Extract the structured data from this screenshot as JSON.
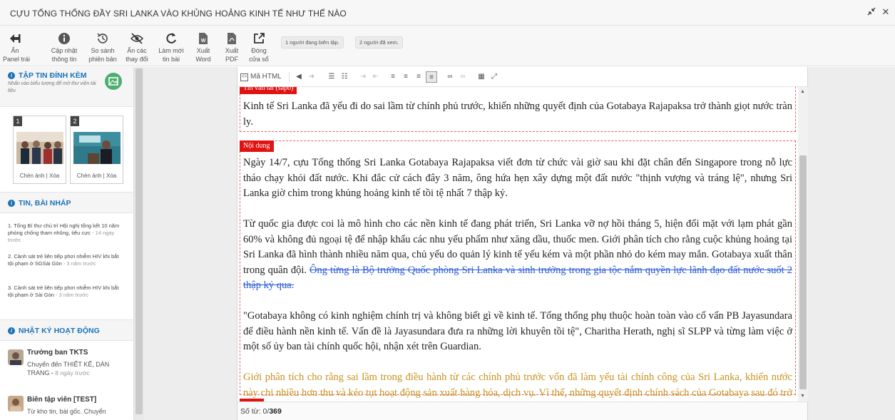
{
  "window": {
    "title": "CỰU TỔNG THỐNG ĐẦY SRI LANKA VÀO KHỦNG HOẢNG KINH TẾ NHƯ THẾ NÀO",
    "collapse_icon": "collapse-arrows-icon",
    "close_label": "✕"
  },
  "toolbar": {
    "buttons": [
      {
        "line1": "Ẩn",
        "line2": "Panel trái",
        "icon": "arrow-left-icon"
      },
      {
        "line1": "Cập nhật",
        "line2": "thông tin",
        "icon": "info-icon"
      },
      {
        "line1": "So sánh",
        "line2": "phiên bản",
        "icon": "history-icon"
      },
      {
        "line1": "Ẩn các",
        "line2": "thay đổi",
        "icon": "eye-slash-icon"
      },
      {
        "line1": "Làm mới",
        "line2": "tin bài",
        "icon": "refresh-icon"
      },
      {
        "line1": "Xuất",
        "line2": "Word",
        "icon": "word-file-icon"
      },
      {
        "line1": "Xuất",
        "line2": "PDF",
        "icon": "pdf-file-icon"
      },
      {
        "line1": "Đóng",
        "line2": "cửa sổ",
        "icon": "external-link-icon"
      }
    ],
    "editing_status": "1 người đang biên tập.",
    "viewed_status": "2 người đã xem."
  },
  "sidebar": {
    "attachments": {
      "title": "TẬP TIN ĐÍNH KÈM",
      "hint": "Nhấn vào biểu tượng để mở thư viện tài liệu",
      "images": [
        {
          "num": "1",
          "caption": "Chèn ảnh | Xóa"
        },
        {
          "num": "2",
          "caption": "Chèn ảnh | Xóa"
        }
      ]
    },
    "drafts": {
      "title": "TIN, BÀI NHÁP",
      "items": [
        {
          "text": "1. Tổng Bí thư chủ trì Hội nghị tổng kết 10 năm phòng chống tham nhũng, tiêu cực",
          "time": " - 14 ngày trước"
        },
        {
          "text": "2. Cảnh sát trẻ liên tiếp phơi nhiễm HIV khi bắt tội phạm ở SGSài Gòn",
          "time": " - 3 năm trước"
        },
        {
          "text": "3. Cảnh sát trẻ liên tiếp phơi nhiễm HIV khi bắt tội phạm ở Sài Gòn",
          "time": " - 3 năm trước"
        }
      ]
    },
    "activity": {
      "title": "NHẬT KÝ HOẠT ĐỘNG",
      "items": [
        {
          "name": "Trưởng ban TKTS",
          "desc": "Chuyển đến THIẾT KẾ, DÀN TRANG",
          "time": " • 8 ngày trước"
        },
        {
          "name": "Biên tập viên [TEST]",
          "desc": "Từ kho tin, bài gốc. Chuyển",
          "time": ""
        }
      ]
    }
  },
  "editor": {
    "html_mode_label": "Mã HTML",
    "sapo_label": "Tin vắn tắt (sapo)",
    "sapo_text": "Kinh tế Sri Lanka đã yếu đi do sai lầm từ chính phủ trước, khiến những quyết định của Gotabaya Rajapaksa trở thành giọt nước tràn ly.",
    "content_label": "Nội dung",
    "paragraphs": {
      "p1": "Ngày 14/7, cựu Tổng thống Sri Lanka Gotabaya Rajapaksa viết đơn từ chức vài giờ sau khi đặt chân đến Singapore trong nỗ lực tháo chạy khỏi đất nước. Khi đắc cử cách đây 3 năm, ông hứa hẹn xây dựng một đất nước \"thịnh vượng và tráng lệ\", nhưng Sri Lanka giờ chìm trong khủng hoảng kinh tế tồi tệ nhất 7 thập kỷ.",
      "p2_plain": "Từ quốc gia được coi là mô hình cho các nền kinh tế đang phát triển, Sri Lanka vỡ nợ hồi tháng 5, hiện đối mặt với lạm phát gần 60% và không đủ ngoại tệ để nhập khẩu các nhu yếu phẩm như xăng dầu, thuốc men. Giới phân tích cho rằng cuộc khủng hoảng tại Sri Lanka đã hình thành nhiều năm qua, chủ yếu do quản lý kinh tế yếu kém và một phần nhỏ do kém may mắn. Gotabaya xuất thân trong quân đội. ",
      "p2_struck": "Ông từng là Bộ trưởng Quốc phòng Sri Lanka và sinh trưởng trong gia tộc nắm quyền lực lãnh đạo đất nước suốt 2 thập kỷ qua.",
      "p3": "\"Gotabaya không có kinh nghiệm chính trị và không biết gì về kinh tế. Tổng thống phụ thuộc hoàn toàn vào cố vấn PB Jayasundara để điều hành nền kinh tế. Vấn đề là Jayasundara đưa ra những lời khuyên tồi tệ\", Charitha Herath, nghị sĩ SLPP và từng làm việc ở một số ủy ban tài chính quốc hội, nhận xét trên Guardian.",
      "p4": "Giới phân tích cho rằng sai lầm trong điều hành từ các chính phủ trước vốn đã làm yếu tài chính công của Sri Lanka, khiến nước này chi nhiều hơn thu và kéo tụt hoạt động sản xuất hàng hóa, dịch vụ. Vì thế, những quyết định chính sách của Gotabaya sau đó trở thành giọt nước tràn ly, chính thức đẩy Sri Lanka vào khủng hoảng"
    },
    "word_count_label": "Số từ: 0/",
    "word_count_total": "369"
  },
  "colors": {
    "accent_blue": "#1a73b8",
    "tag_red": "#e11212",
    "strike_blue": "#2a5bd7",
    "gold_text": "#c8901d"
  }
}
